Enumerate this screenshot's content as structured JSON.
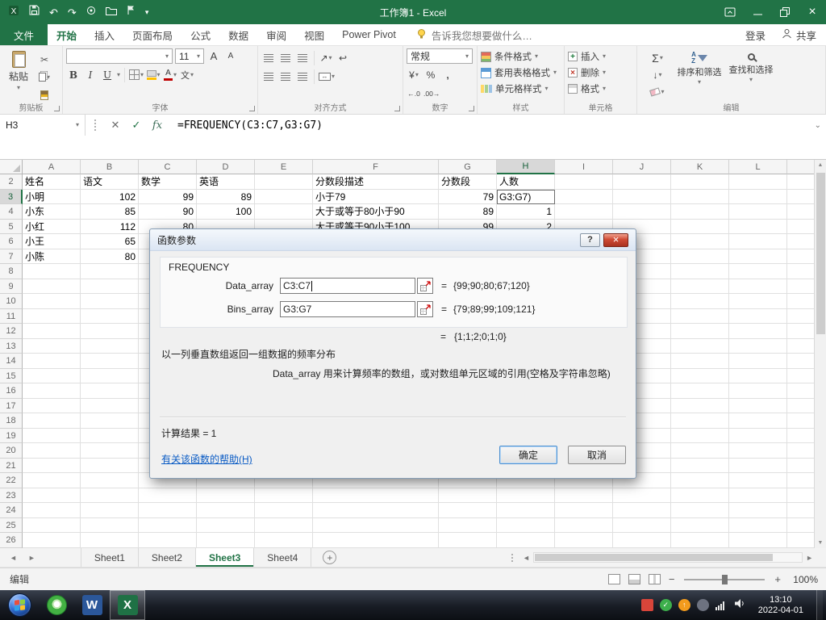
{
  "titlebar": {
    "title": "工作簿1 - Excel"
  },
  "icons": {
    "undo": "↶",
    "redo": "↷",
    "dropdown": "▾",
    "close": "×",
    "formula_cancel": "✕",
    "formula_enter": "✓",
    "formula_fx": "fx",
    "sum": "Σ",
    "fill_down": "↓",
    "cut": "✂",
    "bold": "B",
    "italic": "I",
    "underline": "U",
    "currency": "¥",
    "percent": "%",
    "comma": ",",
    "dec_left": "←.0",
    "dec_right": ".00→",
    "orientation": "↗",
    "wrap": "↩",
    "merge": "↔",
    "phonetic": "文",
    "font_grow": "A",
    "font_shrink": "A",
    "tab_prev": "◄",
    "tab_next": "►",
    "new_sheet": "+",
    "zoom_out": "−",
    "zoom_in": "+",
    "help": "?",
    "word": "W",
    "excel": "X",
    "tray_check": "✓",
    "tray_up": "↑",
    "scroll_up": "▲",
    "scroll_down": "▼",
    "expand_formula_bar": "⌄"
  },
  "ribbon": {
    "file_tab": "文件",
    "tabs": [
      "开始",
      "插入",
      "页面布局",
      "公式",
      "数据",
      "审阅",
      "视图",
      "Power Pivot"
    ],
    "active_tab": "开始",
    "tell_me": "告诉我您想要做什么…",
    "sign_in": "登录",
    "share": "共享",
    "clipboard": {
      "label": "剪贴板",
      "paste": "粘贴"
    },
    "font": {
      "label": "字体",
      "name": "",
      "size": "11"
    },
    "alignment": {
      "label": "对齐方式"
    },
    "number": {
      "label": "数字",
      "format": "常规"
    },
    "styles": {
      "label": "样式",
      "items": [
        "条件格式",
        "套用表格格式",
        "单元格样式"
      ]
    },
    "cells": {
      "label": "单元格",
      "items": [
        "插入",
        "删除",
        "格式"
      ]
    },
    "editing": {
      "label": "编辑",
      "sort": "排序和筛选",
      "find": "查找和选择"
    }
  },
  "formula_bar": {
    "name_box": "H3",
    "formula": "=FREQUENCY(C3:C7,G3:G7)"
  },
  "grid": {
    "columns": [
      "A",
      "B",
      "C",
      "D",
      "E",
      "F",
      "G",
      "H",
      "I",
      "J",
      "K",
      "L"
    ],
    "first_row": 2,
    "last_row": 26,
    "active_cell": "H3",
    "highlight_col": "H",
    "highlight_row": 3,
    "rows": {
      "2": {
        "A": "姓名",
        "B": "语文",
        "C": "数学",
        "D": "英语",
        "F": "分数段描述",
        "G": "分数段",
        "H": "人数"
      },
      "3": {
        "A": "小明",
        "B": "102",
        "C": "99",
        "D": "89",
        "F": "小于79",
        "G": "79",
        "H": "G3:G7)"
      },
      "4": {
        "A": "小东",
        "B": "85",
        "C": "90",
        "D": "100",
        "F": "大于或等于80小于90",
        "G": "89",
        "H": "1"
      },
      "5": {
        "A": "小红",
        "B": "112",
        "C": "80",
        "F": "大于或等于90小于100",
        "G": "99",
        "H": "2"
      },
      "6": {
        "A": "小王",
        "B": "65"
      },
      "7": {
        "A": "小陈",
        "B": "80"
      }
    }
  },
  "dialog": {
    "title": "函数参数",
    "function_name": "FREQUENCY",
    "args": [
      {
        "label": "Data_array",
        "value": "C3:C7",
        "eq": "=",
        "result": "{99;90;80;67;120}"
      },
      {
        "label": "Bins_array",
        "value": "G3:G7",
        "eq": "=",
        "result": "{79;89;99;109;121}"
      }
    ],
    "result_eq": "=",
    "result_value": "{1;1;2;0;1;0}",
    "description": "以一列垂直数组返回一组数据的频率分布",
    "arg_description": "Data_array  用来计算频率的数组，或对数组单元区域的引用(空格及字符串忽略)",
    "calc_result": "计算结果 =  1",
    "help_link": "有关该函数的帮助(H)",
    "ok": "确定",
    "cancel": "取消"
  },
  "sheet_bar": {
    "tabs": [
      "Sheet1",
      "Sheet2",
      "Sheet3",
      "Sheet4"
    ],
    "active": "Sheet3"
  },
  "status_bar": {
    "mode": "编辑",
    "zoom": "100%"
  },
  "taskbar": {
    "time": "13:10",
    "date": "2022-04-01"
  }
}
